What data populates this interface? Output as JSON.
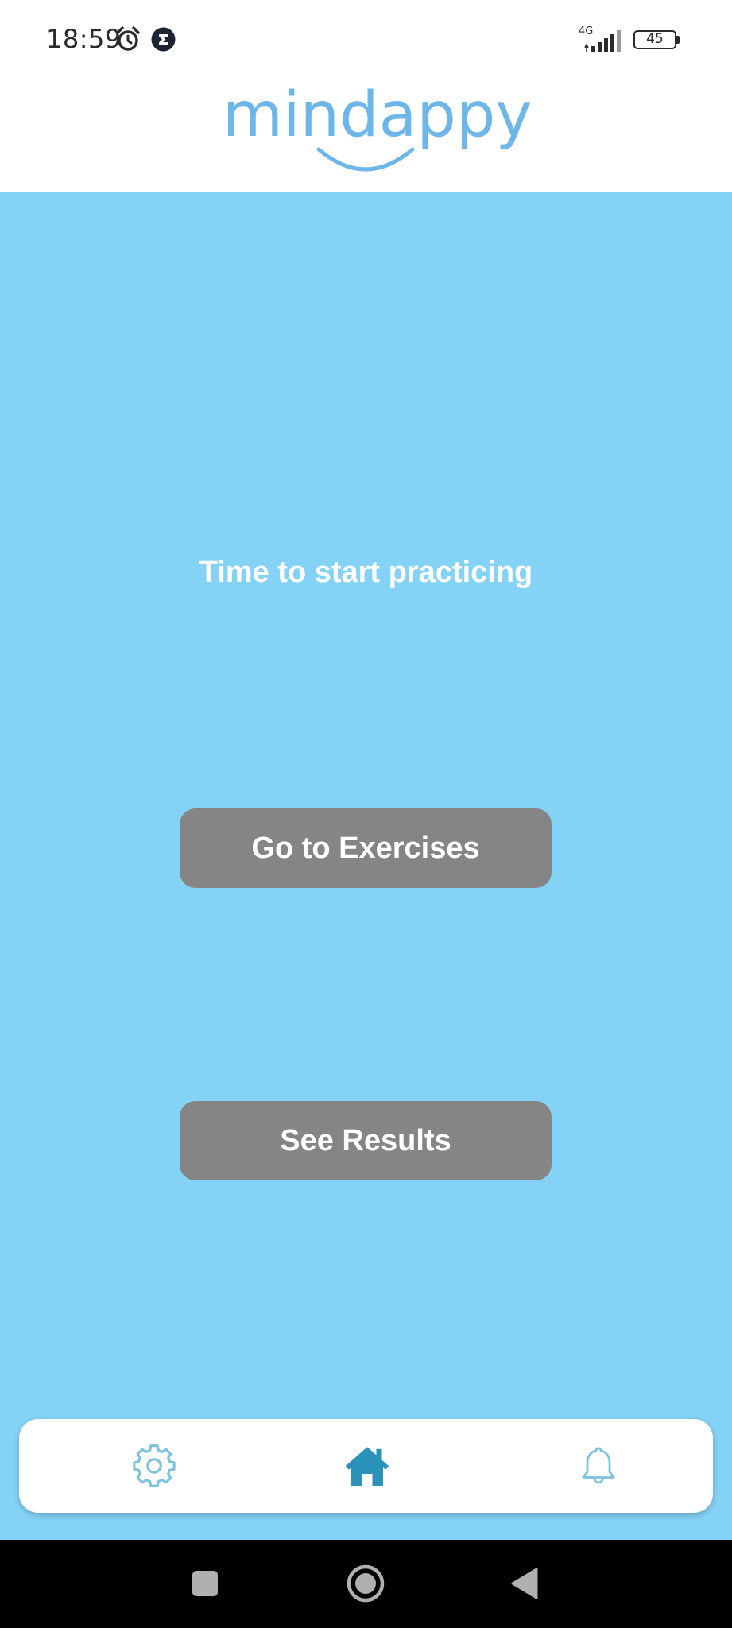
{
  "status_bar": {
    "time": "18:59",
    "network_label": "4G",
    "battery_level": "45",
    "icons": [
      "alarm-icon",
      "app-notification-icon",
      "signal-icon",
      "battery-icon"
    ]
  },
  "header": {
    "logo_text": "mindappy"
  },
  "main": {
    "headline": "Time to start practicing",
    "buttons": {
      "exercises_label": "Go to Exercises",
      "results_label": "See Results"
    }
  },
  "tabbar": {
    "items": [
      {
        "icon": "gear-icon",
        "active": false
      },
      {
        "icon": "home-icon",
        "active": true
      },
      {
        "icon": "bell-icon",
        "active": false
      }
    ]
  },
  "system_nav": {
    "items": [
      "recents-icon",
      "home-circle-icon",
      "back-icon"
    ]
  },
  "colors": {
    "background": "#84d2f6",
    "button": "#858585",
    "logo": "#6cb6ea",
    "tab_active": "#2b93ba",
    "tab_inactive": "#7cc4de"
  }
}
